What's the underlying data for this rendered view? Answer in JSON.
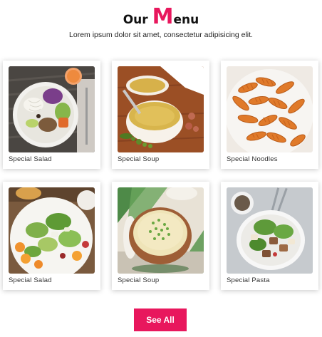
{
  "heading": {
    "prefix": "Our",
    "big_letter": "M",
    "rest": "enu"
  },
  "subtitle": "Lorem ipsum dolor sit amet, consectetur adipisicing elit.",
  "cards": [
    {
      "label": "Special Salad",
      "image": "salad-bowl-image"
    },
    {
      "label": "Special Soup",
      "image": "soup-bowl-image"
    },
    {
      "label": "Special Noodles",
      "image": "fusilli-pasta-image"
    },
    {
      "label": "Special Salad",
      "image": "salad-plate-image"
    },
    {
      "label": "Special Soup",
      "image": "broth-bowl-image"
    },
    {
      "label": "Special Pasta",
      "image": "pasta-salad-bowl-image"
    }
  ],
  "button": {
    "label": "See All"
  },
  "colors": {
    "accent": "#e8175d",
    "text": "#2b2b2b"
  }
}
